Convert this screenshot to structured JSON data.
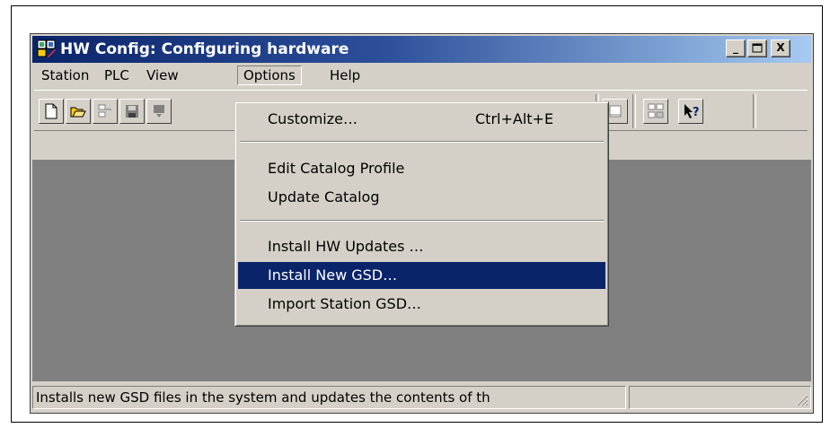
{
  "window": {
    "title": "HW Config: Configuring hardware",
    "title_buttons": [
      "_",
      "□",
      "X"
    ]
  },
  "menubar": {
    "items": [
      "Station",
      "PLC",
      "View",
      "Options",
      "Help"
    ],
    "open_item": "Options"
  },
  "toolbar": {
    "buttons": [
      "new-icon",
      "open-folder-icon",
      "network-icon",
      "save-icon",
      "download-icon",
      "upload-icon",
      "catalog-icon",
      "whats-this-help-icon"
    ]
  },
  "options_menu": {
    "items": [
      {
        "label": "Customize…",
        "shortcut": "Ctrl+Alt+E"
      },
      {
        "label": "Edit Catalog Profile",
        "shortcut": ""
      },
      {
        "label": "Update Catalog",
        "shortcut": ""
      },
      {
        "label": "Install HW Updates …",
        "shortcut": ""
      },
      {
        "label": "Install New GSD…",
        "shortcut": "",
        "highlighted": true
      },
      {
        "label": "Import Station GSD…",
        "shortcut": ""
      }
    ]
  },
  "statusbar": {
    "text": "Installs new GSD files in the system and updates the contents of th"
  },
  "colors": {
    "titlebar_start": "#0a246a",
    "titlebar_end": "#a6caf0",
    "highlight": "#0a246a",
    "face": "#d4d0c8",
    "client": "#808080"
  }
}
